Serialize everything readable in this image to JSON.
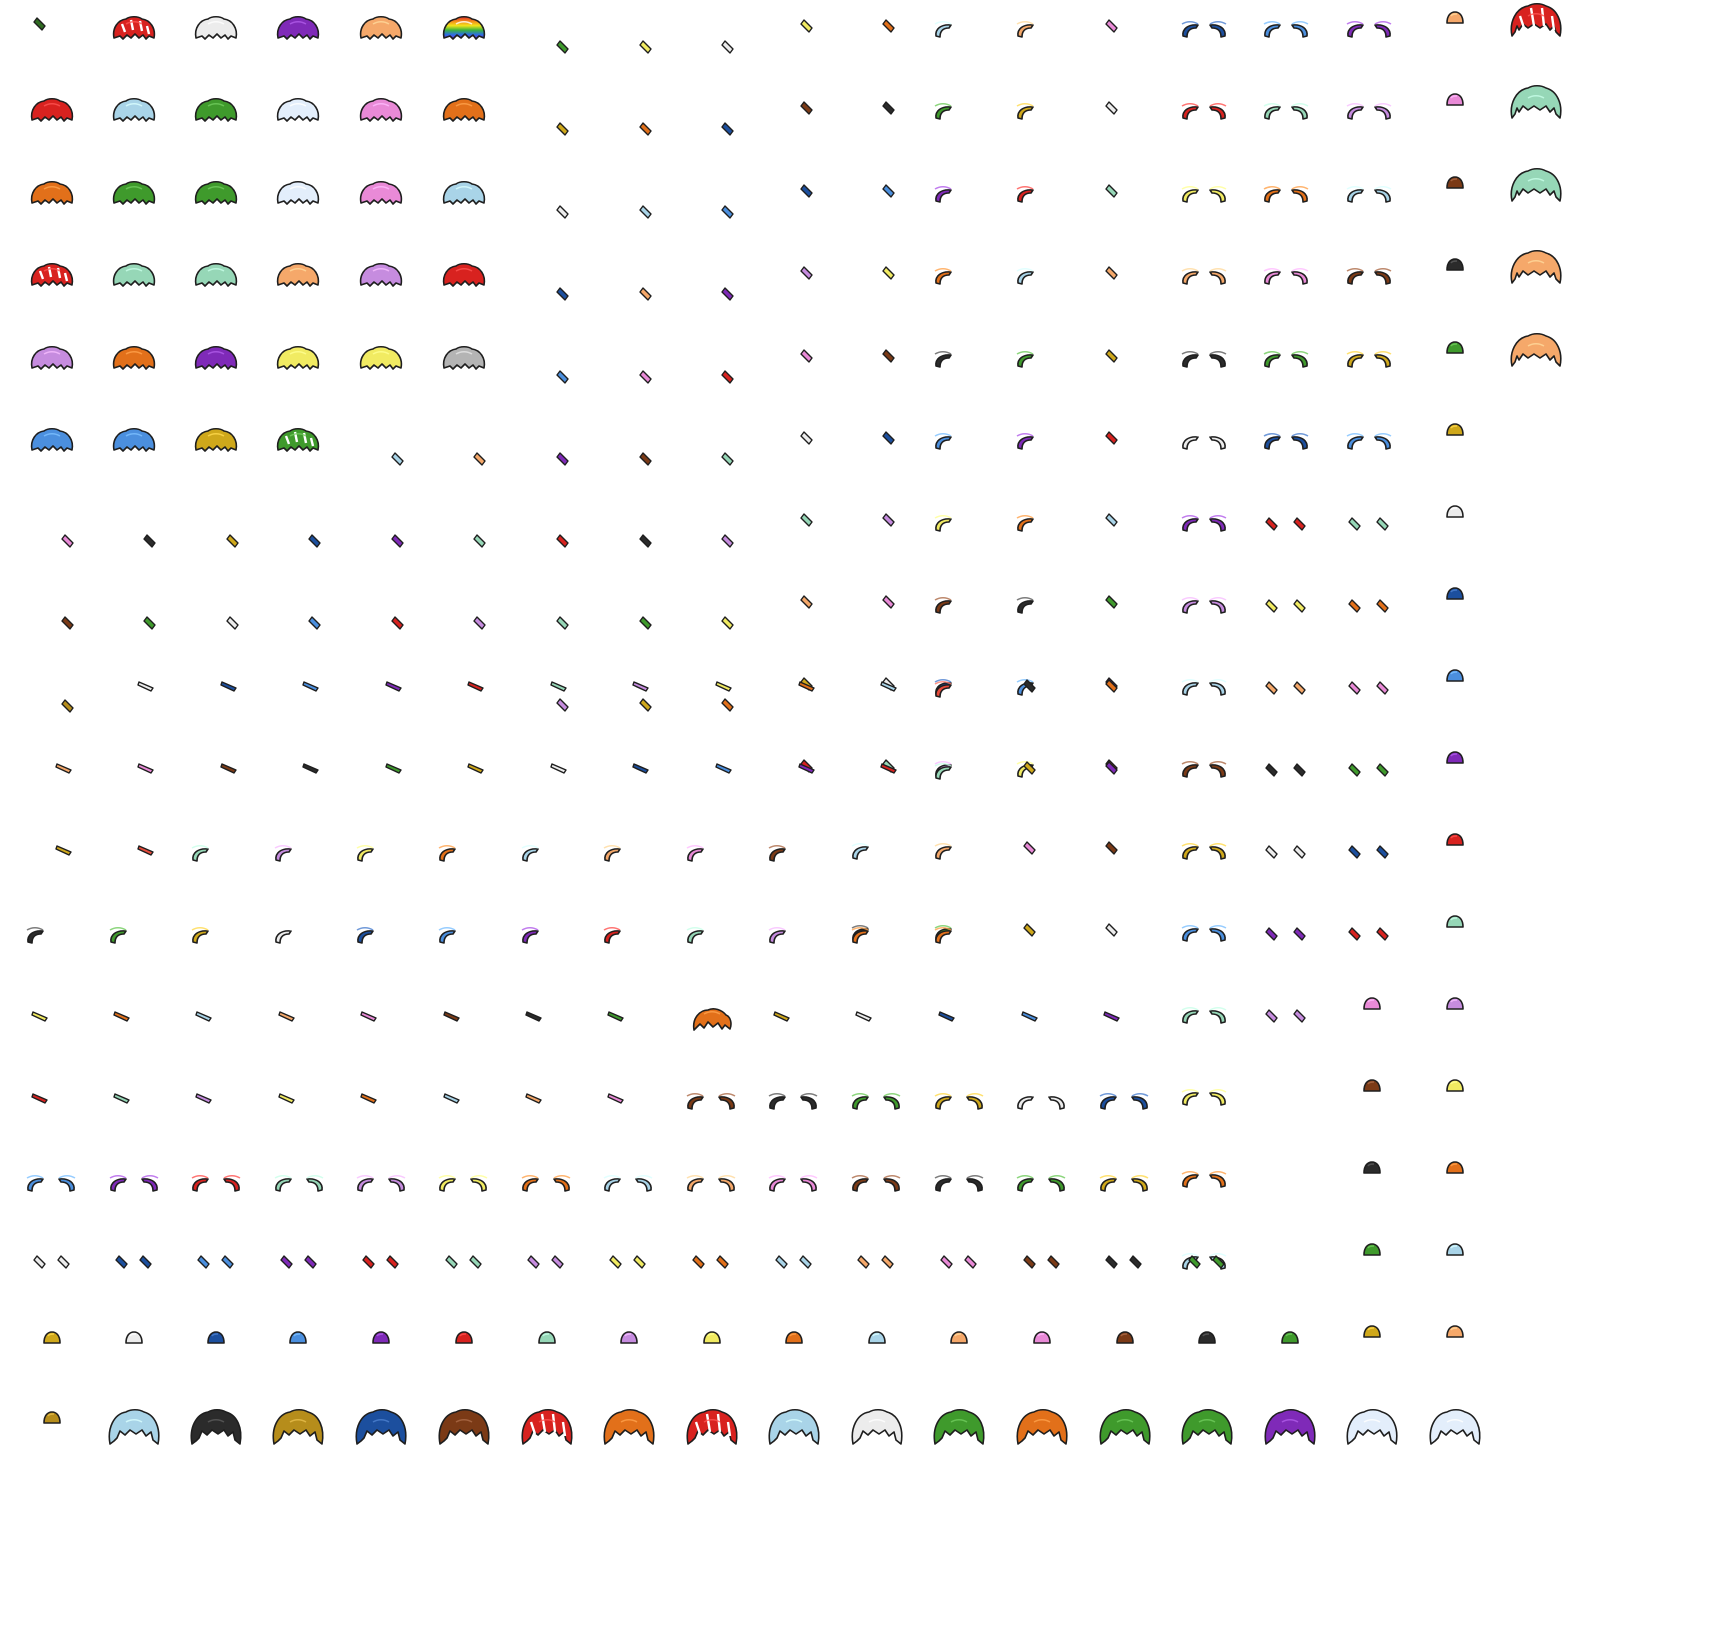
{
  "sheet": {
    "description_visible_text": "",
    "palette": {
      "outline": "#1e1e1e",
      "red": "#d8221f",
      "white": "#ececec",
      "purple": "#7f2ab8",
      "peach": "#f5a86a",
      "lightblue": "#a9d4e8",
      "green": "#3f9a2c",
      "icewhite": "#e3eefb",
      "pink": "#e98ad7",
      "orange": "#e2701a",
      "mint": "#96d7b7",
      "violet": "#c68cdf",
      "lavender": "#cda4ec",
      "yellow": "#f1eb62",
      "gray": "#b4b4b4",
      "blue": "#4b8fde",
      "gold": "#cfa81b",
      "darkgold": "#b68d1b",
      "brown": "#7b3a16",
      "black": "#2b2b2b",
      "navy": "#1c4f9e",
      "darkgreen": "#2f6b22",
      "teal": "#62c6b8",
      "salmon": "#ee8a7e",
      "coral": "#e64a3a"
    },
    "sprites": [
      {
        "kind": "wide",
        "color": "red",
        "pattern": "striped"
      },
      {
        "kind": "wide",
        "color": "white"
      },
      {
        "kind": "wide",
        "color": "purple"
      },
      {
        "kind": "wide",
        "color": "peach"
      },
      {
        "kind": "wide",
        "color": "rainbow"
      },
      {
        "kind": "wide",
        "color": "red"
      },
      {
        "kind": "wide",
        "color": "lightblue"
      },
      {
        "kind": "wide",
        "color": "green"
      },
      {
        "kind": "wide",
        "color": "icewhite"
      },
      {
        "kind": "wide",
        "color": "pink"
      },
      {
        "kind": "wide",
        "color": "orange"
      },
      {
        "kind": "wide",
        "color": "orange"
      },
      {
        "kind": "wide",
        "color": "green"
      },
      {
        "kind": "wide",
        "color": "green"
      },
      {
        "kind": "wide",
        "color": "icewhite"
      },
      {
        "kind": "wide",
        "color": "pink"
      },
      {
        "kind": "wide",
        "color": "lightblue"
      },
      {
        "kind": "wide",
        "color": "red",
        "pattern": "striped"
      },
      {
        "kind": "wide",
        "color": "mint"
      },
      {
        "kind": "wide",
        "color": "mint"
      },
      {
        "kind": "wide",
        "color": "peach"
      },
      {
        "kind": "wide",
        "color": "violet"
      },
      {
        "kind": "wide",
        "color": "red"
      },
      {
        "kind": "wide",
        "color": "violet"
      },
      {
        "kind": "wide",
        "color": "orange"
      },
      {
        "kind": "wide",
        "color": "purple"
      },
      {
        "kind": "wide",
        "color": "yellow"
      },
      {
        "kind": "wide",
        "color": "yellow"
      },
      {
        "kind": "wide",
        "color": "gray"
      },
      {
        "kind": "wide",
        "color": "blue"
      },
      {
        "kind": "wide",
        "color": "blue"
      },
      {
        "kind": "wide",
        "color": "gold"
      },
      {
        "kind": "wide",
        "color": "green",
        "pattern": "striped"
      },
      {
        "kind": "large",
        "color": "red",
        "pattern": "striped"
      },
      {
        "kind": "large",
        "color": "mint"
      },
      {
        "kind": "large",
        "color": "mint"
      },
      {
        "kind": "large",
        "color": "peach"
      },
      {
        "kind": "large",
        "color": "peach"
      },
      {
        "kind": "big",
        "color": "lightblue"
      },
      {
        "kind": "big",
        "color": "black"
      },
      {
        "kind": "big",
        "color": "darkgold"
      },
      {
        "kind": "big",
        "color": "navy"
      },
      {
        "kind": "big",
        "color": "brown"
      },
      {
        "kind": "big",
        "color": "red",
        "pattern": "striped"
      },
      {
        "kind": "big",
        "color": "orange"
      },
      {
        "kind": "big",
        "color": "red",
        "pattern": "striped"
      },
      {
        "kind": "big",
        "color": "lightblue"
      },
      {
        "kind": "big",
        "color": "white"
      },
      {
        "kind": "big",
        "color": "green"
      },
      {
        "kind": "big",
        "color": "orange"
      },
      {
        "kind": "big",
        "color": "green"
      },
      {
        "kind": "big",
        "color": "green"
      },
      {
        "kind": "big",
        "color": "purple"
      },
      {
        "kind": "big",
        "color": "icewhite"
      },
      {
        "kind": "big",
        "color": "icewhite"
      },
      {
        "kind": "fancy",
        "color": "orange"
      }
    ]
  }
}
